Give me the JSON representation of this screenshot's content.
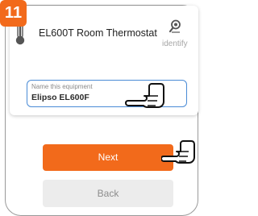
{
  "step": {
    "number": "11"
  },
  "device": {
    "name": "EL600T Room Thermostat",
    "icon": "thermometer-icon"
  },
  "identify": {
    "label": "identify",
    "icon": "search-icon"
  },
  "name_field": {
    "placeholder": "Name this equipment",
    "value": "Elipso EL600F"
  },
  "buttons": {
    "next": "Next",
    "back": "Back"
  },
  "colors": {
    "accent": "#f26a1b",
    "field_border": "#4a8bd6",
    "back_bg": "#ececec"
  }
}
